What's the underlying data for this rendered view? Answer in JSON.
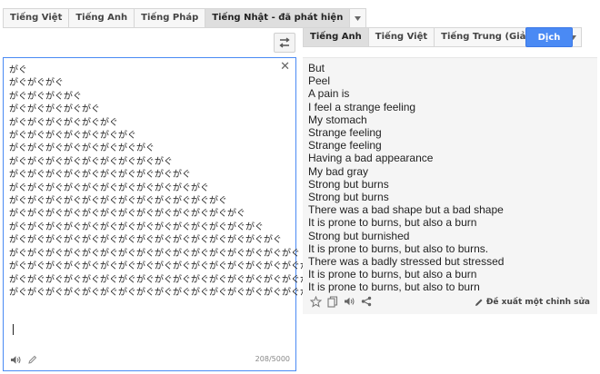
{
  "source_tabs": {
    "items": [
      "Tiếng Việt",
      "Tiếng Anh",
      "Tiếng Pháp",
      "Tiếng Nhật - đã phát hiện"
    ],
    "active_index": 3
  },
  "target_tabs": {
    "items": [
      "Tiếng Anh",
      "Tiếng Việt",
      "Tiếng Trung (Giản Thể)"
    ],
    "active_index": 0
  },
  "translate_button": "Dịch",
  "source": {
    "lines": [
      "がぐ",
      "がぐがぐがぐ",
      "がぐがぐがぐがぐ",
      "がぐがぐがぐがぐがぐ",
      "がぐがぐがぐがぐがぐがぐ",
      "がぐがぐがぐがぐがぐがぐがぐ",
      "がぐがぐがぐがぐがぐがぐがぐがぐ",
      "がぐがぐがぐがぐがぐがぐがぐがぐがぐ",
      "がぐがぐがぐがぐがぐがぐがぐがぐがぐがぐ",
      "がぐがぐがぐがぐがぐがぐがぐがぐがぐがぐがぐ",
      "がぐがぐがぐがぐがぐがぐがぐがぐがぐがぐがぐがぐ",
      "がぐがぐがぐがぐがぐがぐがぐがぐがぐがぐがぐがぐがぐ",
      "がぐがぐがぐがぐがぐがぐがぐがぐがぐがぐがぐがぐがぐがぐ",
      "がぐがぐがぐがぐがぐがぐがぐがぐがぐがぐがぐがぐがぐがぐがぐ",
      "がぐがぐがぐがぐがぐがぐがぐがぐがぐがぐがぐがぐがぐがぐがぐがぐ",
      "がぐがぐがぐがぐがぐがぐがぐがぐがぐがぐがぐがぐがぐがぐがぐがぐがぐ",
      "がぐがぐがぐがぐがぐがぐがぐがぐがぐがぐがぐがぐがぐがぐがぐがぐがぐがぐ",
      "がぐがぐがぐがぐがぐがぐがぐがぐがぐがぐがぐがぐがぐがぐがぐがぐがぐがぐがぐ"
    ],
    "char_count": "208/5000"
  },
  "translation": {
    "lines": [
      "But",
      "Peel",
      "A pain is",
      "I feel a strange feeling",
      "My stomach",
      "Strange feeling",
      "Strange feeling",
      "Having a bad appearance",
      "My bad gray",
      "Strong but burns",
      "Strong but burns",
      "There was a bad shape but a bad shape",
      "It is prone to burns, but also a burn",
      "Strong but burnished",
      "It is prone to burns, but also to burns.",
      "There was a badly stressed but stressed",
      "It is prone to burns, but also a burn",
      "It is prone to burns, but also to burn"
    ],
    "suggest_label": "Đề xuất một chỉnh sửa"
  },
  "colors": {
    "accent": "#4a8af4",
    "target_bg": "#f5f5f5"
  }
}
